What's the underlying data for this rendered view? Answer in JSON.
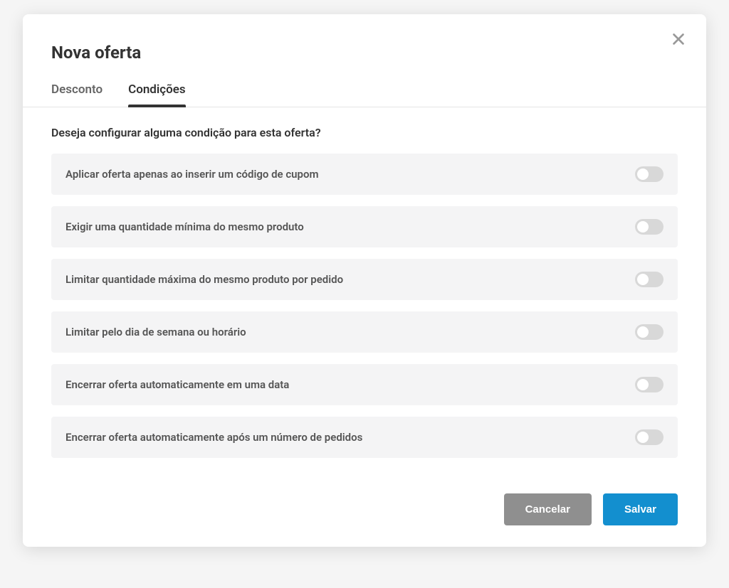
{
  "modal": {
    "title": "Nova oferta"
  },
  "tabs": {
    "discount": "Desconto",
    "conditions": "Condições"
  },
  "question": "Deseja configurar alguma condição para esta oferta?",
  "conditions": [
    {
      "label": "Aplicar oferta apenas ao inserir um código de cupom",
      "enabled": false
    },
    {
      "label": "Exigir uma quantidade mínima do mesmo produto",
      "enabled": false
    },
    {
      "label": "Limitar quantidade máxima do mesmo produto por pedido",
      "enabled": false
    },
    {
      "label": "Limitar pelo dia de semana ou horário",
      "enabled": false
    },
    {
      "label": "Encerrar oferta automaticamente em uma data",
      "enabled": false
    },
    {
      "label": "Encerrar oferta automaticamente após um número de pedidos",
      "enabled": false
    }
  ],
  "footer": {
    "cancel": "Cancelar",
    "save": "Salvar"
  }
}
